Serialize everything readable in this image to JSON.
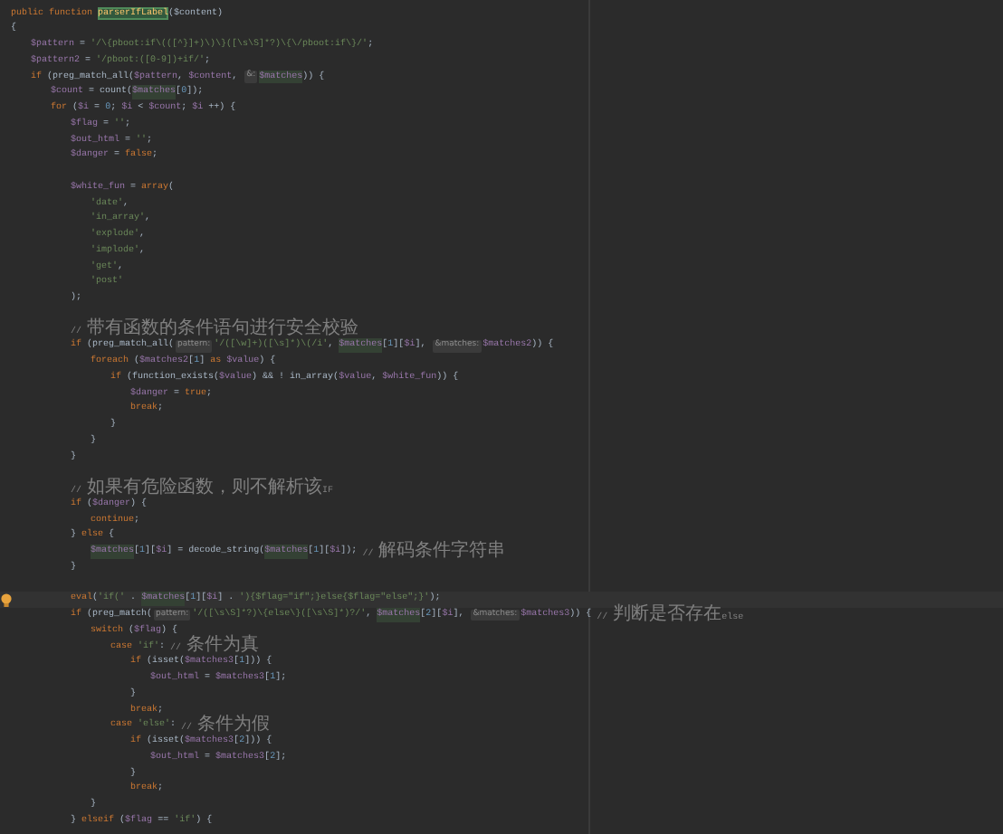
{
  "editor": {
    "lines": [
      {
        "kind": "code",
        "tokens": [
          {
            "kind": "kw",
            "text": "public function "
          },
          {
            "kind": "def",
            "text": "parserIfLabel"
          },
          {
            "kind": "p",
            "text": "($content)"
          }
        ]
      },
      {
        "kind": "code",
        "tokens": [
          {
            "kind": "p",
            "text": "{"
          }
        ],
        "children": [
          {
            "kind": "code",
            "tokens": [
              {
                "kind": "var",
                "text": "$pattern"
              },
              {
                "kind": "p",
                "text": " = "
              },
              {
                "kind": "str",
                "text": "'/\\{pboot:if\\(([^}]+)\\)\\}([\\s\\S]*?)\\{\\/pboot:if\\}/'"
              },
              {
                "kind": "p",
                "text": ";"
              }
            ]
          },
          {
            "kind": "code",
            "tokens": [
              {
                "kind": "var",
                "text": "$pattern2"
              },
              {
                "kind": "p",
                "text": " = "
              },
              {
                "kind": "str",
                "text": "'/pboot:([0-9])+if/'"
              },
              {
                "kind": "p",
                "text": ";"
              }
            ]
          },
          {
            "kind": "code",
            "tokens": [
              {
                "kind": "kw",
                "text": "if "
              },
              {
                "kind": "p",
                "text": "(preg_match_all("
              },
              {
                "kind": "var",
                "text": "$pattern"
              },
              {
                "kind": "p",
                "text": ", "
              },
              {
                "kind": "var",
                "text": "$content"
              },
              {
                "kind": "p",
                "text": ", "
              },
              {
                "kind": "hint",
                "text": "&:"
              },
              {
                "kind": "varhl",
                "text": "$matches"
              },
              {
                "kind": "p",
                "text": ")) {"
              }
            ],
            "children": [
              {
                "kind": "code",
                "tokens": [
                  {
                    "kind": "var",
                    "text": "$count"
                  },
                  {
                    "kind": "p",
                    "text": " = count("
                  },
                  {
                    "kind": "varhl",
                    "text": "$matches"
                  },
                  {
                    "kind": "p",
                    "text": "["
                  },
                  {
                    "kind": "num",
                    "text": "0"
                  },
                  {
                    "kind": "p",
                    "text": "]);"
                  }
                ]
              },
              {
                "kind": "code",
                "tokens": [
                  {
                    "kind": "kw",
                    "text": "for "
                  },
                  {
                    "kind": "p",
                    "text": "("
                  },
                  {
                    "kind": "var",
                    "text": "$i"
                  },
                  {
                    "kind": "p",
                    "text": " = "
                  },
                  {
                    "kind": "num",
                    "text": "0"
                  },
                  {
                    "kind": "p",
                    "text": "; "
                  },
                  {
                    "kind": "var",
                    "text": "$i"
                  },
                  {
                    "kind": "p",
                    "text": " < "
                  },
                  {
                    "kind": "var",
                    "text": "$count"
                  },
                  {
                    "kind": "p",
                    "text": "; "
                  },
                  {
                    "kind": "var",
                    "text": "$i"
                  },
                  {
                    "kind": "p",
                    "text": " ++) {"
                  }
                ],
                "children": [
                  {
                    "kind": "code",
                    "tokens": [
                      {
                        "kind": "var",
                        "text": "$flag"
                      },
                      {
                        "kind": "p",
                        "text": " = "
                      },
                      {
                        "kind": "str",
                        "text": "''"
                      },
                      {
                        "kind": "p",
                        "text": ";"
                      }
                    ]
                  },
                  {
                    "kind": "code",
                    "tokens": [
                      {
                        "kind": "var",
                        "text": "$out_html"
                      },
                      {
                        "kind": "p",
                        "text": " = "
                      },
                      {
                        "kind": "str",
                        "text": "''"
                      },
                      {
                        "kind": "p",
                        "text": ";"
                      }
                    ]
                  },
                  {
                    "kind": "code",
                    "tokens": [
                      {
                        "kind": "var",
                        "text": "$danger"
                      },
                      {
                        "kind": "p",
                        "text": " = "
                      },
                      {
                        "kind": "kw",
                        "text": "false"
                      },
                      {
                        "kind": "p",
                        "text": ";"
                      }
                    ]
                  },
                  {
                    "kind": "blank"
                  },
                  {
                    "kind": "code",
                    "tokens": [
                      {
                        "kind": "var",
                        "text": "$white_fun"
                      },
                      {
                        "kind": "p",
                        "text": " = "
                      },
                      {
                        "kind": "kw",
                        "text": "array"
                      },
                      {
                        "kind": "p",
                        "text": "("
                      }
                    ],
                    "children": [
                      {
                        "kind": "code",
                        "tokens": [
                          {
                            "kind": "str",
                            "text": "'date'"
                          },
                          {
                            "kind": "p",
                            "text": ","
                          }
                        ]
                      },
                      {
                        "kind": "code",
                        "tokens": [
                          {
                            "kind": "str",
                            "text": "'in_array'"
                          },
                          {
                            "kind": "p",
                            "text": ","
                          }
                        ]
                      },
                      {
                        "kind": "code",
                        "tokens": [
                          {
                            "kind": "str",
                            "text": "'explode'"
                          },
                          {
                            "kind": "p",
                            "text": ","
                          }
                        ]
                      },
                      {
                        "kind": "code",
                        "tokens": [
                          {
                            "kind": "str",
                            "text": "'implode'"
                          },
                          {
                            "kind": "p",
                            "text": ","
                          }
                        ]
                      },
                      {
                        "kind": "code",
                        "tokens": [
                          {
                            "kind": "str",
                            "text": "'get'"
                          },
                          {
                            "kind": "p",
                            "text": ","
                          }
                        ]
                      },
                      {
                        "kind": "code",
                        "tokens": [
                          {
                            "kind": "str",
                            "text": "'post'"
                          }
                        ]
                      }
                    ]
                  },
                  {
                    "kind": "code",
                    "tokens": [
                      {
                        "kind": "p",
                        "text": ");"
                      }
                    ]
                  },
                  {
                    "kind": "blank"
                  },
                  {
                    "kind": "code",
                    "tokens": [
                      {
                        "kind": "cmt",
                        "text": "// 带有函数的条件语句进行安全校验"
                      }
                    ]
                  },
                  {
                    "kind": "code",
                    "tokens": [
                      {
                        "kind": "kw",
                        "text": "if "
                      },
                      {
                        "kind": "p",
                        "text": "(preg_match_all("
                      },
                      {
                        "kind": "hint",
                        "text": "pattern:"
                      },
                      {
                        "kind": "str",
                        "text": "'/([\\w]+)([\\s]*)\\(/i'"
                      },
                      {
                        "kind": "p",
                        "text": ", "
                      },
                      {
                        "kind": "varhl",
                        "text": "$matches"
                      },
                      {
                        "kind": "p",
                        "text": "["
                      },
                      {
                        "kind": "num",
                        "text": "1"
                      },
                      {
                        "kind": "p",
                        "text": "]["
                      },
                      {
                        "kind": "var",
                        "text": "$i"
                      },
                      {
                        "kind": "p",
                        "text": "], "
                      },
                      {
                        "kind": "hint",
                        "text": "&matches:"
                      },
                      {
                        "kind": "var",
                        "text": "$matches2"
                      },
                      {
                        "kind": "p",
                        "text": ")) {"
                      }
                    ],
                    "children": [
                      {
                        "kind": "code",
                        "tokens": [
                          {
                            "kind": "kw",
                            "text": "foreach "
                          },
                          {
                            "kind": "p",
                            "text": "("
                          },
                          {
                            "kind": "var",
                            "text": "$matches2"
                          },
                          {
                            "kind": "p",
                            "text": "["
                          },
                          {
                            "kind": "num",
                            "text": "1"
                          },
                          {
                            "kind": "p",
                            "text": "] "
                          },
                          {
                            "kind": "kw",
                            "text": "as "
                          },
                          {
                            "kind": "var",
                            "text": "$value"
                          },
                          {
                            "kind": "p",
                            "text": ") {"
                          }
                        ],
                        "children": [
                          {
                            "kind": "code",
                            "tokens": [
                              {
                                "kind": "kw",
                                "text": "if "
                              },
                              {
                                "kind": "p",
                                "text": "(function_exists("
                              },
                              {
                                "kind": "var",
                                "text": "$value"
                              },
                              {
                                "kind": "p",
                                "text": ") && ! in_array("
                              },
                              {
                                "kind": "var",
                                "text": "$value"
                              },
                              {
                                "kind": "p",
                                "text": ", "
                              },
                              {
                                "kind": "var",
                                "text": "$white_fun"
                              },
                              {
                                "kind": "p",
                                "text": ")) {"
                              }
                            ],
                            "children": [
                              {
                                "kind": "code",
                                "tokens": [
                                  {
                                    "kind": "var",
                                    "text": "$danger"
                                  },
                                  {
                                    "kind": "p",
                                    "text": " = "
                                  },
                                  {
                                    "kind": "kw",
                                    "text": "true"
                                  },
                                  {
                                    "kind": "p",
                                    "text": ";"
                                  }
                                ]
                              },
                              {
                                "kind": "code",
                                "tokens": [
                                  {
                                    "kind": "kw",
                                    "text": "break"
                                  },
                                  {
                                    "kind": "p",
                                    "text": ";"
                                  }
                                ]
                              }
                            ]
                          },
                          {
                            "kind": "code",
                            "tokens": [
                              {
                                "kind": "p",
                                "text": "}"
                              }
                            ]
                          }
                        ]
                      },
                      {
                        "kind": "code",
                        "tokens": [
                          {
                            "kind": "p",
                            "text": "}"
                          }
                        ]
                      }
                    ]
                  },
                  {
                    "kind": "code",
                    "tokens": [
                      {
                        "kind": "p",
                        "text": "}"
                      }
                    ]
                  },
                  {
                    "kind": "blank"
                  },
                  {
                    "kind": "code",
                    "tokens": [
                      {
                        "kind": "cmt",
                        "text": "// 如果有危险函数，则不解析该IF"
                      }
                    ]
                  },
                  {
                    "kind": "code",
                    "tokens": [
                      {
                        "kind": "kw",
                        "text": "if "
                      },
                      {
                        "kind": "p",
                        "text": "("
                      },
                      {
                        "kind": "var",
                        "text": "$danger"
                      },
                      {
                        "kind": "p",
                        "text": ") {"
                      }
                    ],
                    "children": [
                      {
                        "kind": "code",
                        "tokens": [
                          {
                            "kind": "kw",
                            "text": "continue"
                          },
                          {
                            "kind": "p",
                            "text": ";"
                          }
                        ]
                      }
                    ]
                  },
                  {
                    "kind": "code",
                    "tokens": [
                      {
                        "kind": "p",
                        "text": "} "
                      },
                      {
                        "kind": "kw",
                        "text": "else "
                      },
                      {
                        "kind": "p",
                        "text": "{"
                      }
                    ],
                    "children": [
                      {
                        "kind": "code",
                        "tokens": [
                          {
                            "kind": "varhl",
                            "text": "$matches"
                          },
                          {
                            "kind": "p",
                            "text": "["
                          },
                          {
                            "kind": "num",
                            "text": "1"
                          },
                          {
                            "kind": "p",
                            "text": "]["
                          },
                          {
                            "kind": "var",
                            "text": "$i"
                          },
                          {
                            "kind": "p",
                            "text": "] = decode_string("
                          },
                          {
                            "kind": "varhl",
                            "text": "$matches"
                          },
                          {
                            "kind": "p",
                            "text": "["
                          },
                          {
                            "kind": "num",
                            "text": "1"
                          },
                          {
                            "kind": "p",
                            "text": "]["
                          },
                          {
                            "kind": "var",
                            "text": "$i"
                          },
                          {
                            "kind": "p",
                            "text": "]); "
                          },
                          {
                            "kind": "cmt",
                            "text": "// 解码条件字符串"
                          }
                        ]
                      }
                    ]
                  },
                  {
                    "kind": "code",
                    "tokens": [
                      {
                        "kind": "p",
                        "text": "}"
                      }
                    ]
                  },
                  {
                    "kind": "blank"
                  },
                  {
                    "kind": "code",
                    "current": true,
                    "tokens": [
                      {
                        "kind": "kw",
                        "text": "eval"
                      },
                      {
                        "kind": "p",
                        "text": "("
                      },
                      {
                        "kind": "str",
                        "text": "'if('"
                      },
                      {
                        "kind": "p",
                        "text": " . "
                      },
                      {
                        "kind": "varhl",
                        "text": "$matches"
                      },
                      {
                        "kind": "p",
                        "text": "["
                      },
                      {
                        "kind": "num",
                        "text": "1"
                      },
                      {
                        "kind": "p",
                        "text": "]["
                      },
                      {
                        "kind": "var",
                        "text": "$i"
                      },
                      {
                        "kind": "p",
                        "text": "] . "
                      },
                      {
                        "kind": "str",
                        "text": "'){$flag=\"if\";}else{$flag=\"else\";}'"
                      },
                      {
                        "kind": "p",
                        "text": ");"
                      }
                    ]
                  },
                  {
                    "kind": "code",
                    "tokens": [
                      {
                        "kind": "kw",
                        "text": "if "
                      },
                      {
                        "kind": "p",
                        "text": "(preg_match("
                      },
                      {
                        "kind": "hint",
                        "text": "pattern:"
                      },
                      {
                        "kind": "str",
                        "text": "'/([\\s\\S]*?)\\{else\\}([\\s\\S]*)?/'"
                      },
                      {
                        "kind": "p",
                        "text": ", "
                      },
                      {
                        "kind": "varhl",
                        "text": "$matches"
                      },
                      {
                        "kind": "p",
                        "text": "["
                      },
                      {
                        "kind": "num",
                        "text": "2"
                      },
                      {
                        "kind": "p",
                        "text": "]["
                      },
                      {
                        "kind": "var",
                        "text": "$i"
                      },
                      {
                        "kind": "p",
                        "text": "], "
                      },
                      {
                        "kind": "hint",
                        "text": "&matches:"
                      },
                      {
                        "kind": "var",
                        "text": "$matches3"
                      },
                      {
                        "kind": "p",
                        "text": ")) { "
                      },
                      {
                        "kind": "cmt",
                        "text": "// 判断是否存在else"
                      }
                    ],
                    "children": [
                      {
                        "kind": "code",
                        "tokens": [
                          {
                            "kind": "kw",
                            "text": "switch "
                          },
                          {
                            "kind": "p",
                            "text": "("
                          },
                          {
                            "kind": "var",
                            "text": "$flag"
                          },
                          {
                            "kind": "p",
                            "text": ") {"
                          }
                        ],
                        "children": [
                          {
                            "kind": "code",
                            "tokens": [
                              {
                                "kind": "kw",
                                "text": "case "
                              },
                              {
                                "kind": "str",
                                "text": "'if'"
                              },
                              {
                                "kind": "p",
                                "text": ": "
                              },
                              {
                                "kind": "cmt",
                                "text": "// 条件为真"
                              }
                            ],
                            "children": [
                              {
                                "kind": "code",
                                "tokens": [
                                  {
                                    "kind": "kw",
                                    "text": "if "
                                  },
                                  {
                                    "kind": "p",
                                    "text": "(isset("
                                  },
                                  {
                                    "kind": "var",
                                    "text": "$matches3"
                                  },
                                  {
                                    "kind": "p",
                                    "text": "["
                                  },
                                  {
                                    "kind": "num",
                                    "text": "1"
                                  },
                                  {
                                    "kind": "p",
                                    "text": "])) {"
                                  }
                                ],
                                "children": [
                                  {
                                    "kind": "code",
                                    "tokens": [
                                      {
                                        "kind": "var",
                                        "text": "$out_html"
                                      },
                                      {
                                        "kind": "p",
                                        "text": " = "
                                      },
                                      {
                                        "kind": "var",
                                        "text": "$matches3"
                                      },
                                      {
                                        "kind": "p",
                                        "text": "["
                                      },
                                      {
                                        "kind": "num",
                                        "text": "1"
                                      },
                                      {
                                        "kind": "p",
                                        "text": "];"
                                      }
                                    ]
                                  }
                                ]
                              },
                              {
                                "kind": "code",
                                "tokens": [
                                  {
                                    "kind": "p",
                                    "text": "}"
                                  }
                                ]
                              },
                              {
                                "kind": "code",
                                "tokens": [
                                  {
                                    "kind": "kw",
                                    "text": "break"
                                  },
                                  {
                                    "kind": "p",
                                    "text": ";"
                                  }
                                ]
                              }
                            ]
                          },
                          {
                            "kind": "code",
                            "tokens": [
                              {
                                "kind": "kw",
                                "text": "case "
                              },
                              {
                                "kind": "str",
                                "text": "'else'"
                              },
                              {
                                "kind": "p",
                                "text": ": "
                              },
                              {
                                "kind": "cmt",
                                "text": "// 条件为假"
                              }
                            ],
                            "children": [
                              {
                                "kind": "code",
                                "tokens": [
                                  {
                                    "kind": "kw",
                                    "text": "if "
                                  },
                                  {
                                    "kind": "p",
                                    "text": "(isset("
                                  },
                                  {
                                    "kind": "var",
                                    "text": "$matches3"
                                  },
                                  {
                                    "kind": "p",
                                    "text": "["
                                  },
                                  {
                                    "kind": "num",
                                    "text": "2"
                                  },
                                  {
                                    "kind": "p",
                                    "text": "])) {"
                                  }
                                ],
                                "children": [
                                  {
                                    "kind": "code",
                                    "tokens": [
                                      {
                                        "kind": "var",
                                        "text": "$out_html"
                                      },
                                      {
                                        "kind": "p",
                                        "text": " = "
                                      },
                                      {
                                        "kind": "var",
                                        "text": "$matches3"
                                      },
                                      {
                                        "kind": "p",
                                        "text": "["
                                      },
                                      {
                                        "kind": "num",
                                        "text": "2"
                                      },
                                      {
                                        "kind": "p",
                                        "text": "];"
                                      }
                                    ]
                                  }
                                ]
                              },
                              {
                                "kind": "code",
                                "tokens": [
                                  {
                                    "kind": "p",
                                    "text": "}"
                                  }
                                ]
                              },
                              {
                                "kind": "code",
                                "tokens": [
                                  {
                                    "kind": "kw",
                                    "text": "break"
                                  },
                                  {
                                    "kind": "p",
                                    "text": ";"
                                  }
                                ]
                              }
                            ]
                          }
                        ]
                      },
                      {
                        "kind": "code",
                        "tokens": [
                          {
                            "kind": "p",
                            "text": "}"
                          }
                        ]
                      }
                    ]
                  },
                  {
                    "kind": "code",
                    "tokens": [
                      {
                        "kind": "p",
                        "text": "} "
                      },
                      {
                        "kind": "kw",
                        "text": "elseif "
                      },
                      {
                        "kind": "p",
                        "text": "("
                      },
                      {
                        "kind": "var",
                        "text": "$flag"
                      },
                      {
                        "kind": "p",
                        "text": " == "
                      },
                      {
                        "kind": "str",
                        "text": "'if'"
                      },
                      {
                        "kind": "p",
                        "text": ") {"
                      }
                    ]
                  }
                ]
              }
            ]
          }
        ]
      }
    ]
  }
}
